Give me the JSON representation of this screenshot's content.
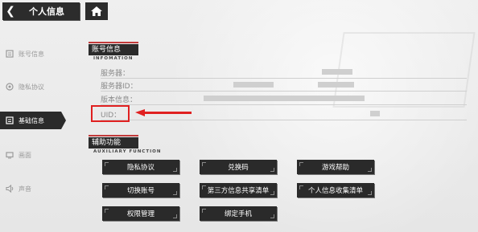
{
  "header": {
    "back_icon": "chevron-left-icon",
    "title": "个人信息",
    "home_icon": "home-icon"
  },
  "sidebar": {
    "items": [
      {
        "label": "账号信息",
        "icon": "account-icon",
        "active": false
      },
      {
        "label": "隐私协议",
        "icon": "privacy-icon",
        "active": false
      },
      {
        "label": "基础信息",
        "icon": "info-icon",
        "active": true
      },
      {
        "label": "画面",
        "icon": "display-icon",
        "active": false
      },
      {
        "label": "声音",
        "icon": "speaker-icon",
        "active": false
      }
    ]
  },
  "account_section": {
    "title": "账号信息",
    "subtitle": "INFOMATION",
    "rows": [
      {
        "label": "服务器："
      },
      {
        "label": "服务器ID："
      },
      {
        "label": "版本信息："
      },
      {
        "label": "UID："
      }
    ]
  },
  "aux_section": {
    "title": "辅助功能",
    "subtitle": "AUXILIARY FUNCTION",
    "buttons": [
      [
        "隐私协议",
        "兑换码",
        "游戏帮助"
      ],
      [
        "切换账号",
        "第三方信息共享清单",
        "个人信息收集清单"
      ],
      [
        "权限管理",
        "绑定手机"
      ]
    ]
  },
  "colors": {
    "accent_red": "#e02020",
    "panel_dark": "#2b2b2b",
    "background": "#ececec"
  }
}
